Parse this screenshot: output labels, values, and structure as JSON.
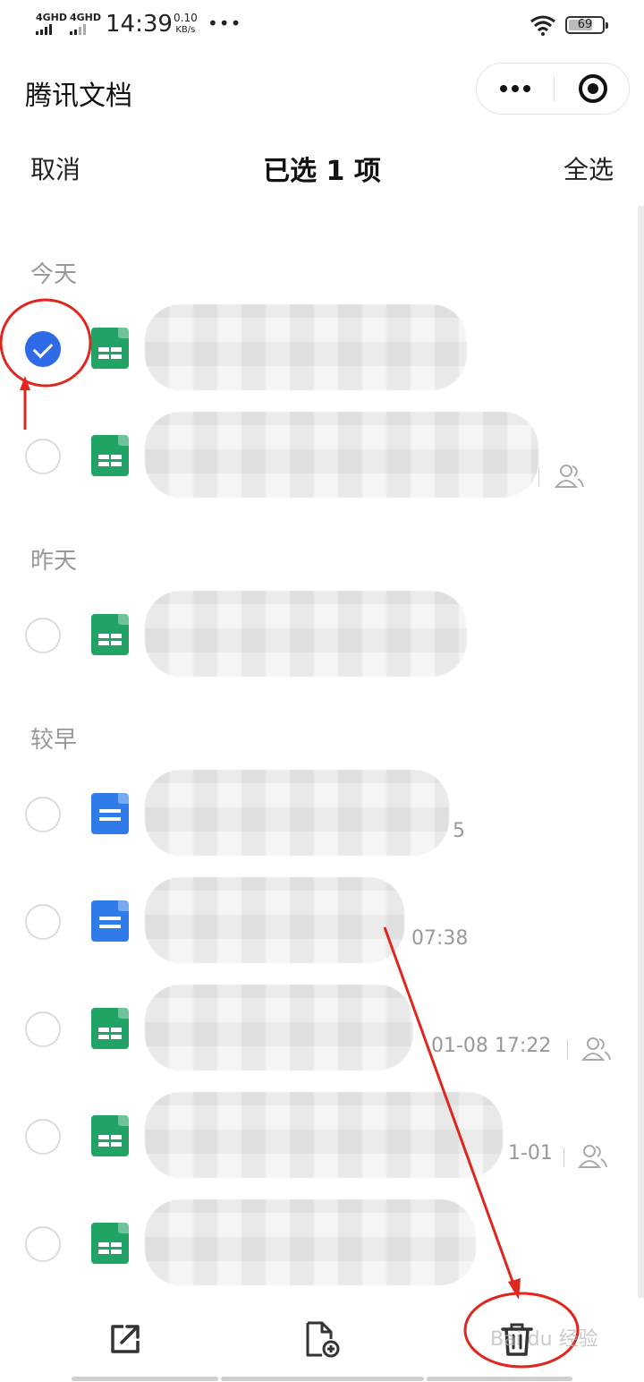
{
  "status_bar": {
    "sim1": "4GHD",
    "sim2": "4GHD",
    "time": "14:39",
    "speed_value": "0.10",
    "speed_unit": "KB/s",
    "more": "•••",
    "battery": "69"
  },
  "app": {
    "title": "腾讯文档",
    "menu_icon": "more-dots-icon",
    "close_icon": "target-close-icon"
  },
  "selection": {
    "cancel_label": "取消",
    "title": "已选 1 项",
    "select_all_label": "全选"
  },
  "sections": {
    "today": "今天",
    "yesterday": "昨天",
    "earlier": "较早"
  },
  "files": [
    {
      "type": "sheet",
      "selected": true,
      "meta": "",
      "shared": false
    },
    {
      "type": "sheet",
      "selected": false,
      "meta": "",
      "shared": true
    },
    {
      "type": "sheet",
      "selected": false,
      "meta": "",
      "shared": false
    },
    {
      "type": "doc",
      "selected": false,
      "meta": "5",
      "shared": false
    },
    {
      "type": "doc",
      "selected": false,
      "meta": "07:38",
      "shared": false
    },
    {
      "type": "sheet",
      "selected": false,
      "meta": "01-08 17:22",
      "shared": true
    },
    {
      "type": "sheet",
      "selected": false,
      "meta": "1-01",
      "shared": true
    },
    {
      "type": "sheet",
      "selected": false,
      "meta": "",
      "shared": false
    }
  ],
  "toolbar": {
    "share_icon": "share-external-icon",
    "add_icon": "add-file-icon",
    "delete_icon": "trash-icon"
  },
  "watermark": "Bai du 经验",
  "colors": {
    "accent_blue": "#2f6ae6",
    "sheet_green": "#21a366",
    "doc_blue": "#2f7bea",
    "annotation_red": "#e0261f"
  }
}
